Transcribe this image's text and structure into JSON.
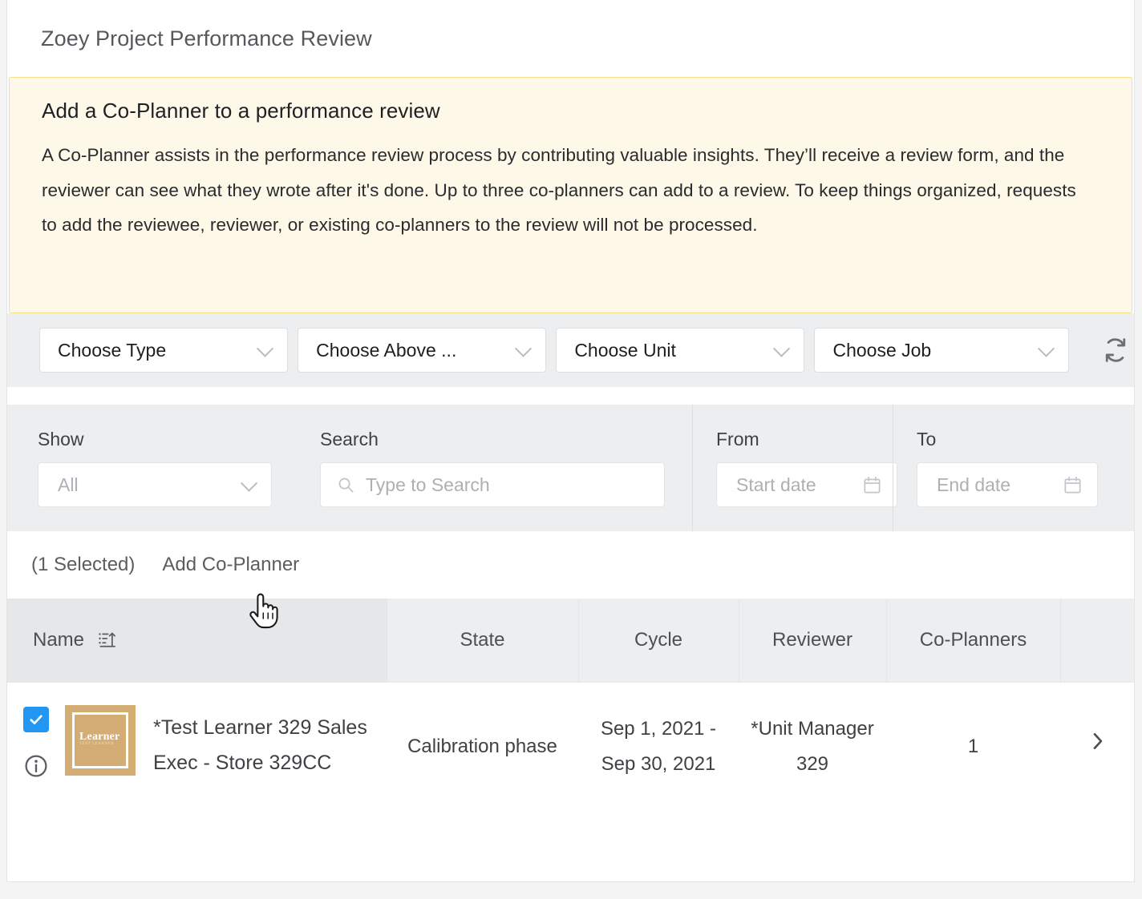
{
  "header": {
    "title": "Zoey Project Performance Review"
  },
  "notice": {
    "title": "Add a Co-Planner to a performance review",
    "body": "A Co-Planner assists in the performance review process by contributing valuable insights. They’ll receive a review form, and the reviewer can see what they wrote after it's done. Up to three co-planners can add to a review. To keep things organized, requests to add the reviewee, reviewer, or existing co-planners to the review will not be processed.",
    "bg_color": "#fdf8e8",
    "border_color": "#f6de8c"
  },
  "selectors": {
    "type": "Choose Type",
    "above": "Choose Above ...",
    "unit": "Choose Unit",
    "job": "Choose Job",
    "refresh_icon": "refresh-icon"
  },
  "filters": {
    "show_label": "Show",
    "show_value": "All",
    "search_label": "Search",
    "search_placeholder": "Type to Search",
    "from_label": "From",
    "from_placeholder": "Start date",
    "to_label": "To",
    "to_placeholder": "End date"
  },
  "actions": {
    "selected_count": "(1 Selected)",
    "add_co_planner": "Add Co-Planner"
  },
  "table": {
    "columns": [
      "Name",
      "State",
      "Cycle",
      "Reviewer",
      "Co-Planners",
      ""
    ],
    "sort_icon": "sort-ascending-icon",
    "rows": [
      {
        "selected": true,
        "avatar_label": "Learner",
        "avatar_sublabel": "TEST LEARNER",
        "avatar_color": "#d3ad74",
        "name": "*Test Learner 329 Sales Exec - Store 329CC",
        "state": "Calibration phase",
        "cycle": "Sep 1, 2021 - Sep 30, 2021",
        "reviewer": "*Unit Manager 329",
        "co_planners": "1",
        "expand_icon": "chevron-right-icon"
      }
    ]
  },
  "colors": {
    "accent": "#2196f3",
    "panel_gray": "#eceef0",
    "header_gray": "#e6e7e9"
  }
}
